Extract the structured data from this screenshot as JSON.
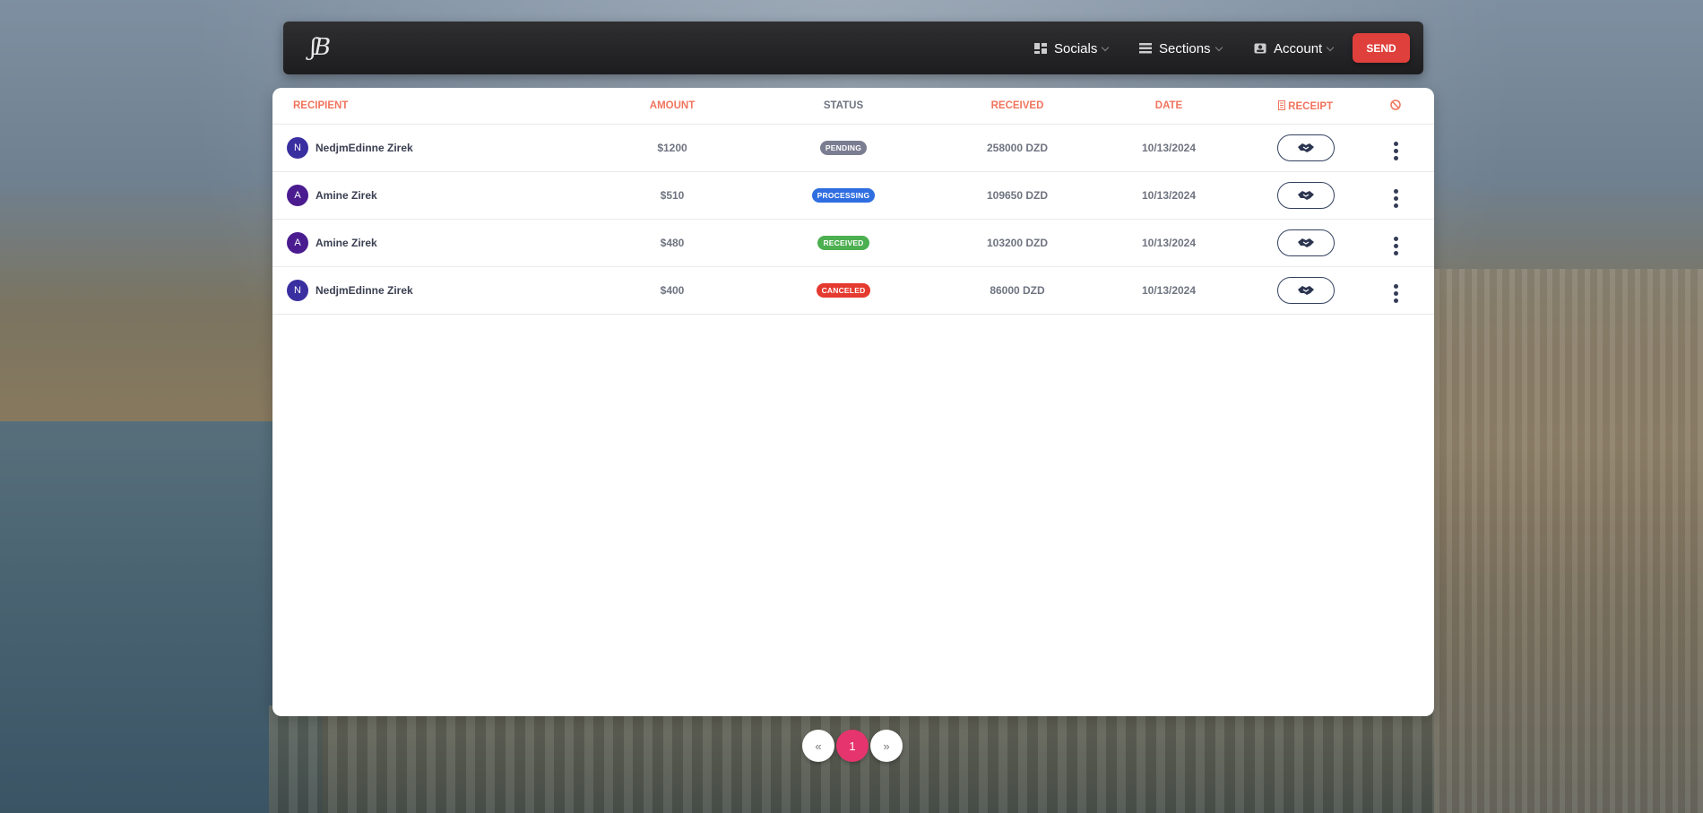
{
  "navbar": {
    "logo_text": "ʃB",
    "items": [
      {
        "label": "Socials",
        "icon": "dashboard-icon"
      },
      {
        "label": "Sections",
        "icon": "list-icon"
      },
      {
        "label": "Account",
        "icon": "account-box-icon"
      }
    ],
    "send_label": "SEND"
  },
  "table": {
    "headers": {
      "recipient": "RECIPIENT",
      "amount": "AMOUNT",
      "status": "STATUS",
      "received": "RECEIVED",
      "date": "DATE",
      "receipt": "RECEIPT",
      "cancel_icon": "block-icon",
      "receipt_icon": "receipt-icon"
    },
    "rows": [
      {
        "initial": "N",
        "name": "NedjmEdinne Zirek",
        "avatar_color": "#3a2fa0",
        "amount": "$1200",
        "status": "PENDING",
        "status_color": "#7b7d91",
        "received": "258000 DZD",
        "date": "10/13/2024"
      },
      {
        "initial": "A",
        "name": "Amine Zirek",
        "avatar_color": "#4a1c8f",
        "amount": "$510",
        "status": "PROCESSING",
        "status_color": "#2f6ee0",
        "received": "109650 DZD",
        "date": "10/13/2024"
      },
      {
        "initial": "A",
        "name": "Amine Zirek",
        "avatar_color": "#4a1c8f",
        "amount": "$480",
        "status": "RECEIVED",
        "status_color": "#4caf50",
        "received": "103200 DZD",
        "date": "10/13/2024"
      },
      {
        "initial": "N",
        "name": "NedjmEdinne Zirek",
        "avatar_color": "#3a2fa0",
        "amount": "$400",
        "status": "CANCELED",
        "status_color": "#e53a2f",
        "received": "86000 DZD",
        "date": "10/13/2024"
      }
    ],
    "row_button_icon": "handshake-icon",
    "row_menu_icon": "more-vert-icon"
  },
  "pagination": {
    "prev": "«",
    "current": "1",
    "next": "»"
  },
  "colors": {
    "accent": "#e6356e",
    "header_text": "#f0745e",
    "send_button": "#e0403c"
  }
}
